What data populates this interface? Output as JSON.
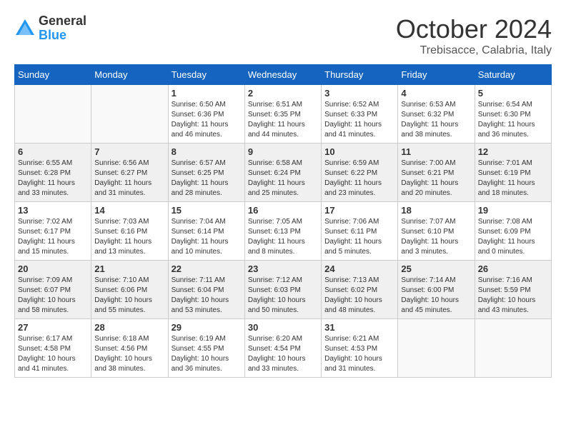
{
  "logo": {
    "general": "General",
    "blue": "Blue"
  },
  "title": "October 2024",
  "subtitle": "Trebisacce, Calabria, Italy",
  "weekdays": [
    "Sunday",
    "Monday",
    "Tuesday",
    "Wednesday",
    "Thursday",
    "Friday",
    "Saturday"
  ],
  "weeks": [
    [
      {
        "day": "",
        "info": ""
      },
      {
        "day": "",
        "info": ""
      },
      {
        "day": "1",
        "sunrise": "6:50 AM",
        "sunset": "6:36 PM",
        "daylight": "11 hours and 46 minutes."
      },
      {
        "day": "2",
        "sunrise": "6:51 AM",
        "sunset": "6:35 PM",
        "daylight": "11 hours and 44 minutes."
      },
      {
        "day": "3",
        "sunrise": "6:52 AM",
        "sunset": "6:33 PM",
        "daylight": "11 hours and 41 minutes."
      },
      {
        "day": "4",
        "sunrise": "6:53 AM",
        "sunset": "6:32 PM",
        "daylight": "11 hours and 38 minutes."
      },
      {
        "day": "5",
        "sunrise": "6:54 AM",
        "sunset": "6:30 PM",
        "daylight": "11 hours and 36 minutes."
      }
    ],
    [
      {
        "day": "6",
        "sunrise": "6:55 AM",
        "sunset": "6:28 PM",
        "daylight": "11 hours and 33 minutes."
      },
      {
        "day": "7",
        "sunrise": "6:56 AM",
        "sunset": "6:27 PM",
        "daylight": "11 hours and 31 minutes."
      },
      {
        "day": "8",
        "sunrise": "6:57 AM",
        "sunset": "6:25 PM",
        "daylight": "11 hours and 28 minutes."
      },
      {
        "day": "9",
        "sunrise": "6:58 AM",
        "sunset": "6:24 PM",
        "daylight": "11 hours and 25 minutes."
      },
      {
        "day": "10",
        "sunrise": "6:59 AM",
        "sunset": "6:22 PM",
        "daylight": "11 hours and 23 minutes."
      },
      {
        "day": "11",
        "sunrise": "7:00 AM",
        "sunset": "6:21 PM",
        "daylight": "11 hours and 20 minutes."
      },
      {
        "day": "12",
        "sunrise": "7:01 AM",
        "sunset": "6:19 PM",
        "daylight": "11 hours and 18 minutes."
      }
    ],
    [
      {
        "day": "13",
        "sunrise": "7:02 AM",
        "sunset": "6:17 PM",
        "daylight": "11 hours and 15 minutes."
      },
      {
        "day": "14",
        "sunrise": "7:03 AM",
        "sunset": "6:16 PM",
        "daylight": "11 hours and 13 minutes."
      },
      {
        "day": "15",
        "sunrise": "7:04 AM",
        "sunset": "6:14 PM",
        "daylight": "11 hours and 10 minutes."
      },
      {
        "day": "16",
        "sunrise": "7:05 AM",
        "sunset": "6:13 PM",
        "daylight": "11 hours and 8 minutes."
      },
      {
        "day": "17",
        "sunrise": "7:06 AM",
        "sunset": "6:11 PM",
        "daylight": "11 hours and 5 minutes."
      },
      {
        "day": "18",
        "sunrise": "7:07 AM",
        "sunset": "6:10 PM",
        "daylight": "11 hours and 3 minutes."
      },
      {
        "day": "19",
        "sunrise": "7:08 AM",
        "sunset": "6:09 PM",
        "daylight": "11 hours and 0 minutes."
      }
    ],
    [
      {
        "day": "20",
        "sunrise": "7:09 AM",
        "sunset": "6:07 PM",
        "daylight": "10 hours and 58 minutes."
      },
      {
        "day": "21",
        "sunrise": "7:10 AM",
        "sunset": "6:06 PM",
        "daylight": "10 hours and 55 minutes."
      },
      {
        "day": "22",
        "sunrise": "7:11 AM",
        "sunset": "6:04 PM",
        "daylight": "10 hours and 53 minutes."
      },
      {
        "day": "23",
        "sunrise": "7:12 AM",
        "sunset": "6:03 PM",
        "daylight": "10 hours and 50 minutes."
      },
      {
        "day": "24",
        "sunrise": "7:13 AM",
        "sunset": "6:02 PM",
        "daylight": "10 hours and 48 minutes."
      },
      {
        "day": "25",
        "sunrise": "7:14 AM",
        "sunset": "6:00 PM",
        "daylight": "10 hours and 45 minutes."
      },
      {
        "day": "26",
        "sunrise": "7:16 AM",
        "sunset": "5:59 PM",
        "daylight": "10 hours and 43 minutes."
      }
    ],
    [
      {
        "day": "27",
        "sunrise": "6:17 AM",
        "sunset": "4:58 PM",
        "daylight": "10 hours and 41 minutes."
      },
      {
        "day": "28",
        "sunrise": "6:18 AM",
        "sunset": "4:56 PM",
        "daylight": "10 hours and 38 minutes."
      },
      {
        "day": "29",
        "sunrise": "6:19 AM",
        "sunset": "4:55 PM",
        "daylight": "10 hours and 36 minutes."
      },
      {
        "day": "30",
        "sunrise": "6:20 AM",
        "sunset": "4:54 PM",
        "daylight": "10 hours and 33 minutes."
      },
      {
        "day": "31",
        "sunrise": "6:21 AM",
        "sunset": "4:53 PM",
        "daylight": "10 hours and 31 minutes."
      },
      {
        "day": "",
        "info": ""
      },
      {
        "day": "",
        "info": ""
      }
    ]
  ]
}
